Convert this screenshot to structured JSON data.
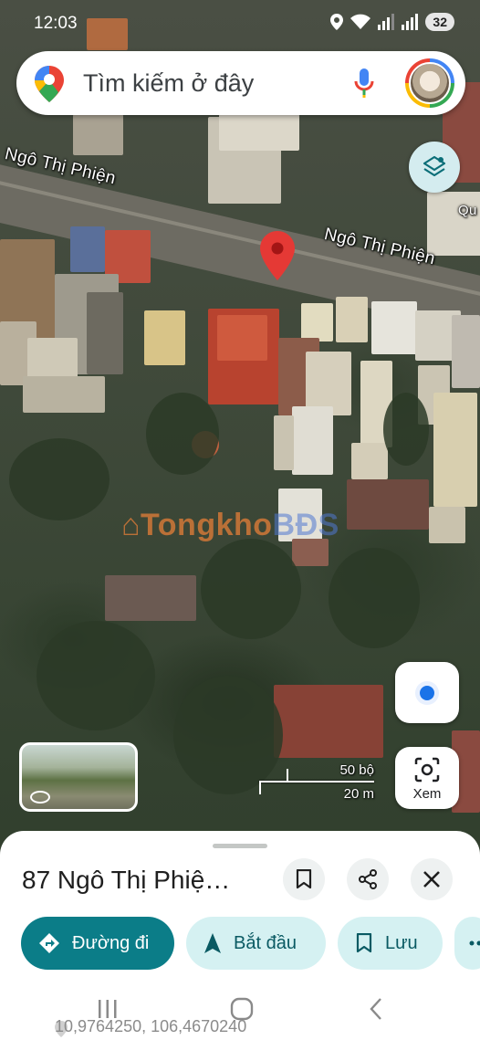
{
  "status_bar": {
    "time": "12:03",
    "battery": "32"
  },
  "search": {
    "placeholder": "Tìm kiếm ở đây"
  },
  "map": {
    "street_labels": [
      "Ngô Thị Phiện",
      "Ngô Thị Phiện",
      "Qu"
    ],
    "watermark": {
      "part1": "Tongkho",
      "part2": "BĐS"
    },
    "scale": {
      "feet": "50 bộ",
      "meters": "20 m"
    }
  },
  "xem_button": {
    "label": "Xem"
  },
  "place": {
    "title": "87 Ngô Thị Phiệ…",
    "coordinates": "10,9764250, 106,4670240"
  },
  "actions": {
    "directions": "Đường đi",
    "start": "Bắt đầu",
    "save": "Lưu"
  },
  "colors": {
    "primary": "#0b7d88",
    "tonal": "#d5f1f2",
    "marker": "#e53935",
    "location_dot": "#1a73e8"
  },
  "icons": [
    "location-pin-icon",
    "mic-icon",
    "layers-icon",
    "my-location-icon",
    "lens-camera-icon",
    "street-view-icon",
    "bookmark-icon",
    "share-icon",
    "close-icon",
    "directions-icon",
    "navigation-arrow-icon",
    "recents-icon",
    "home-icon",
    "back-icon"
  ]
}
